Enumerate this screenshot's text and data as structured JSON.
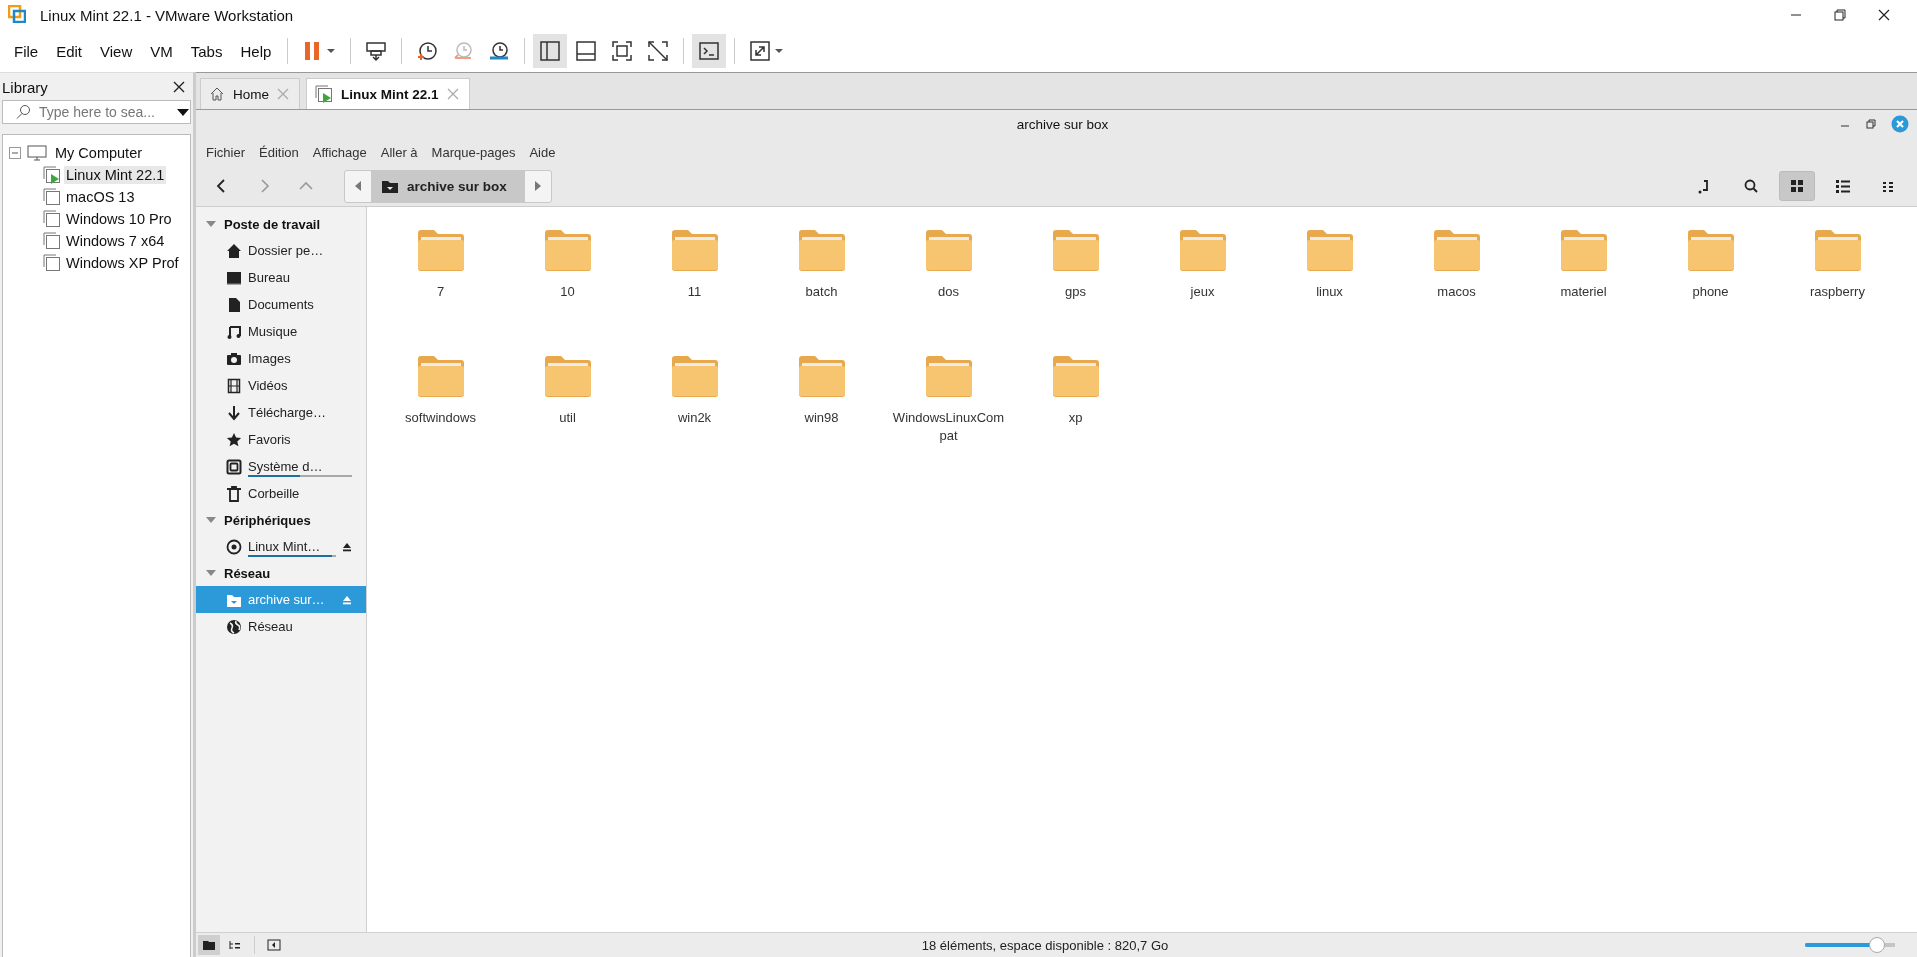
{
  "window": {
    "title": "Linux Mint 22.1 - VMware Workstation"
  },
  "menu": [
    "File",
    "Edit",
    "View",
    "VM",
    "Tabs",
    "Help"
  ],
  "toolbar": [
    {
      "kind": "pause",
      "selected": false
    },
    {
      "kind": "sendkeys",
      "selected": false
    },
    {
      "kind": "snaptake",
      "selected": false
    },
    {
      "kind": "snaprevert",
      "selected": false
    },
    {
      "kind": "snapmanage",
      "selected": false
    },
    {
      "kind": "library",
      "selected": true
    },
    {
      "kind": "thumbs",
      "selected": false
    },
    {
      "kind": "fullscreen",
      "selected": false
    },
    {
      "kind": "unity",
      "selected": false
    },
    {
      "kind": "console",
      "selected": true
    },
    {
      "kind": "stretch",
      "selected": false
    }
  ],
  "library": {
    "title": "Library",
    "search": {
      "placeholder": "Type here to sea..."
    },
    "tree": [
      {
        "label": "My Computer",
        "expanded": true,
        "children": [
          {
            "label": "Linux Mint 22.1",
            "selected": true,
            "running": true
          },
          {
            "label": "macOS 13",
            "selected": false,
            "running": false
          },
          {
            "label": "Windows 10 Pro",
            "selected": false,
            "running": false
          },
          {
            "label": "Windows 7 x64",
            "selected": false,
            "running": false
          },
          {
            "label": "Windows XP Prof",
            "selected": false,
            "running": false
          }
        ]
      }
    ]
  },
  "tabs": [
    {
      "label": "Home",
      "kind": "home",
      "selected": false
    },
    {
      "label": "Linux Mint 22.1",
      "kind": "vm",
      "selected": true
    }
  ],
  "guest": {
    "title": "archive sur box",
    "menu": [
      "Fichier",
      "Édition",
      "Affichage",
      "Aller à",
      "Marque-pages",
      "Aide"
    ],
    "path": {
      "label": "archive sur box"
    },
    "view_buttons": [
      {
        "kind": "location",
        "selected": false
      },
      {
        "kind": "search",
        "selected": false
      },
      {
        "kind": "grid",
        "selected": true
      },
      {
        "kind": "list",
        "selected": false
      },
      {
        "kind": "compact",
        "selected": false
      }
    ],
    "sidebar": [
      {
        "label": "Poste de travail",
        "expanded": true,
        "children": [
          {
            "label": "Dossier pe…",
            "kind": "home",
            "selected": false
          },
          {
            "label": "Bureau",
            "kind": "desktop",
            "selected": false
          },
          {
            "label": "Documents",
            "kind": "document",
            "selected": false
          },
          {
            "label": "Musique",
            "kind": "music",
            "selected": false
          },
          {
            "label": "Images",
            "kind": "camera",
            "selected": false
          },
          {
            "label": "Vidéos",
            "kind": "film",
            "selected": false
          },
          {
            "label": "Télécharge…",
            "kind": "download",
            "selected": false
          },
          {
            "label": "Favoris",
            "kind": "star",
            "selected": false
          },
          {
            "label": "Système d…",
            "kind": "drive",
            "selected": false,
            "level": 0.5
          },
          {
            "label": "Corbeille",
            "kind": "trash",
            "selected": false
          }
        ]
      },
      {
        "label": "Périphériques",
        "expanded": true,
        "children": [
          {
            "label": "Linux Mint…",
            "kind": "disc",
            "selected": false,
            "level": 0.95,
            "eject": true
          }
        ]
      },
      {
        "label": "Réseau",
        "expanded": true,
        "children": [
          {
            "label": "archive sur…",
            "kind": "share",
            "selected": true,
            "eject": true
          },
          {
            "label": "Réseau",
            "kind": "globe",
            "selected": false
          }
        ]
      }
    ],
    "files": [
      "7",
      "10",
      "11",
      "batch",
      "dos",
      "gps",
      "jeux",
      "linux",
      "macos",
      "materiel",
      "phone",
      "raspberry",
      "softwindows",
      "util",
      "win2k",
      "win98",
      "WindowsLinuxCompat",
      "xp"
    ],
    "status": "18 éléments, espace disponible : 820,7 Go",
    "zoom": {
      "level": 0.8
    }
  }
}
